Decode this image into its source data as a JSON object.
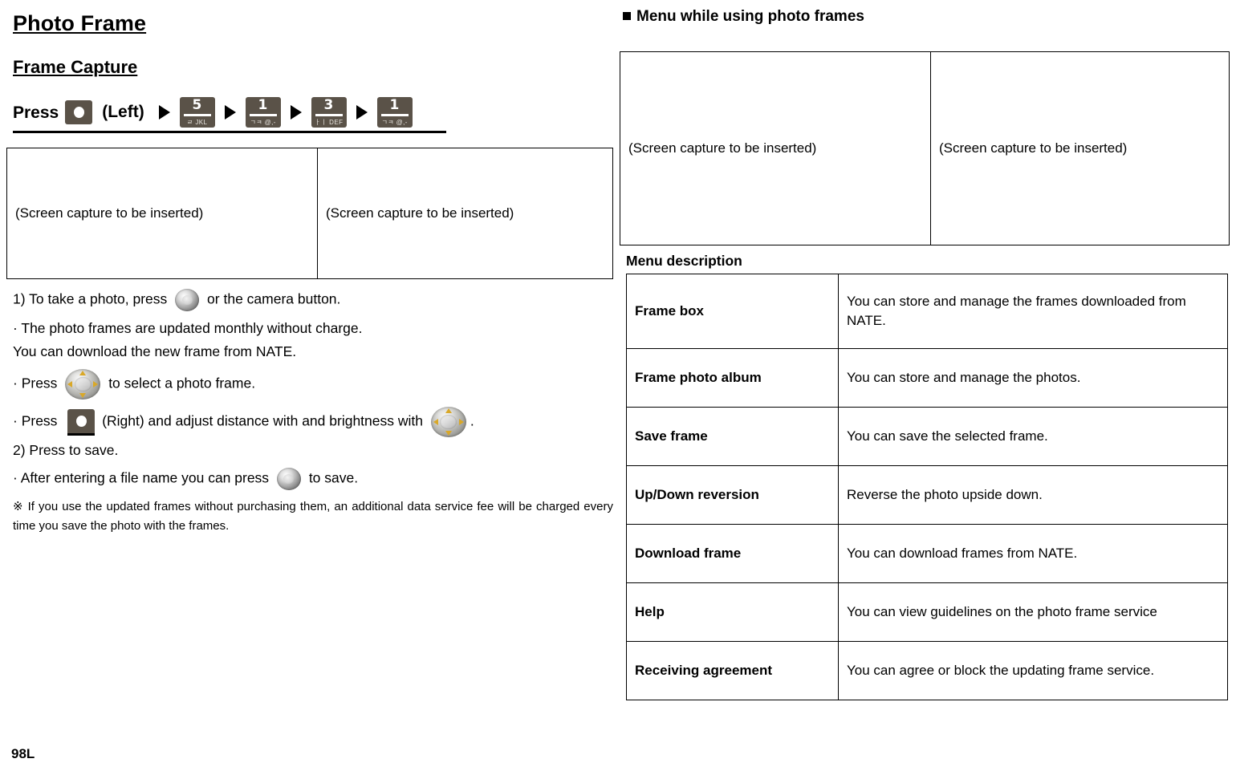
{
  "document": {
    "title": "Photo Frame",
    "subtitle": "Frame Capture",
    "page_footer": "98L"
  },
  "press_sequence": {
    "press_label": "Press",
    "left_label": "(Left)",
    "arrow_glyph": "▶",
    "keys": [
      {
        "icon": "softkey-left-icon",
        "type": "softkey"
      },
      {
        "icon": "keypad-5-icon",
        "type": "numeric",
        "digit": "5",
        "sub": "ㄹ JKL"
      },
      {
        "icon": "keypad-1-icon",
        "type": "numeric",
        "digit": "1",
        "sub": "ㄱㅋ @,-"
      },
      {
        "icon": "keypad-3-icon",
        "type": "numeric",
        "digit": "3",
        "sub": "ㅏㅣ DEF"
      },
      {
        "icon": "keypad-1b-icon",
        "type": "numeric",
        "digit": "1",
        "sub": "ㄱㅋ @,-"
      }
    ]
  },
  "left_capture_table": {
    "cells": [
      "(Screen capture to be inserted)",
      "(Screen capture to be inserted)"
    ]
  },
  "instructions": {
    "step1_a": "1) To take a photo, press",
    "step1_b": "or the camera button.",
    "bullet_update_1": "· The photo frames are updated monthly without charge.",
    "bullet_update_2": "You can download the new frame from NATE.",
    "bullet_select_a": "· Press",
    "bullet_select_b": "to select a photo frame.",
    "bullet_right_a": "· Press",
    "bullet_right_b": "(Right) and adjust distance with and brightness with",
    "bullet_right_c": ".",
    "step2": "2) Press to save.",
    "bullet_save_a": "· After entering a file name you can press",
    "bullet_save_b": "to save.",
    "note": "※ If you use the updated frames without purchasing them, an additional data service fee will be charged every time you save the photo with the frames."
  },
  "right_panel": {
    "heading": "Menu while using photo frames",
    "capture_cells": [
      "(Screen capture to be inserted)",
      "(Screen capture to be inserted)"
    ],
    "menu_description_label": "Menu description",
    "menu_rows": [
      {
        "name": "Frame box",
        "description": "You can store and manage the frames downloaded from NATE."
      },
      {
        "name": "Frame photo album",
        "description": "You can store and manage the photos."
      },
      {
        "name": "Save frame",
        "description": "  You can save the selected frame."
      },
      {
        "name": "Up/Down reversion",
        "description": "Reverse the photo upside down."
      },
      {
        "name": "Download frame",
        "description": "You can download frames from NATE."
      },
      {
        "name": "Help",
        "description": "You can view guidelines on the photo frame service"
      },
      {
        "name": "Receiving agreement",
        "description": "  You can agree or block the updating frame service."
      }
    ]
  },
  "colors": {
    "key_body": "#5a5248",
    "key_text": "#ffffff",
    "arrow_accent": "#d9a828",
    "border": "#000000"
  }
}
